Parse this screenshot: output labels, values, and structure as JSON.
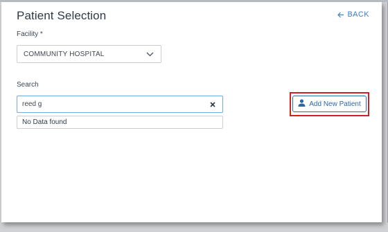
{
  "dialog": {
    "title": "Patient Selection",
    "back_label": "BACK"
  },
  "facility": {
    "label": "Facility",
    "required_marker": "*",
    "selected_value": "COMMUNITY HOSPITAL"
  },
  "search": {
    "label": "Search",
    "value": "reed g",
    "no_results_text": "No Data found"
  },
  "actions": {
    "add_new_patient_label": "Add New Patient"
  },
  "colors": {
    "accent": "#3d7fc1",
    "button_border": "#2f67a3",
    "highlight": "#d21f24"
  },
  "icons": {
    "back": "arrow-left-icon",
    "facility_dropdown": "chevron-down-icon",
    "clear_search": "close-icon",
    "add_patient": "person-icon"
  }
}
